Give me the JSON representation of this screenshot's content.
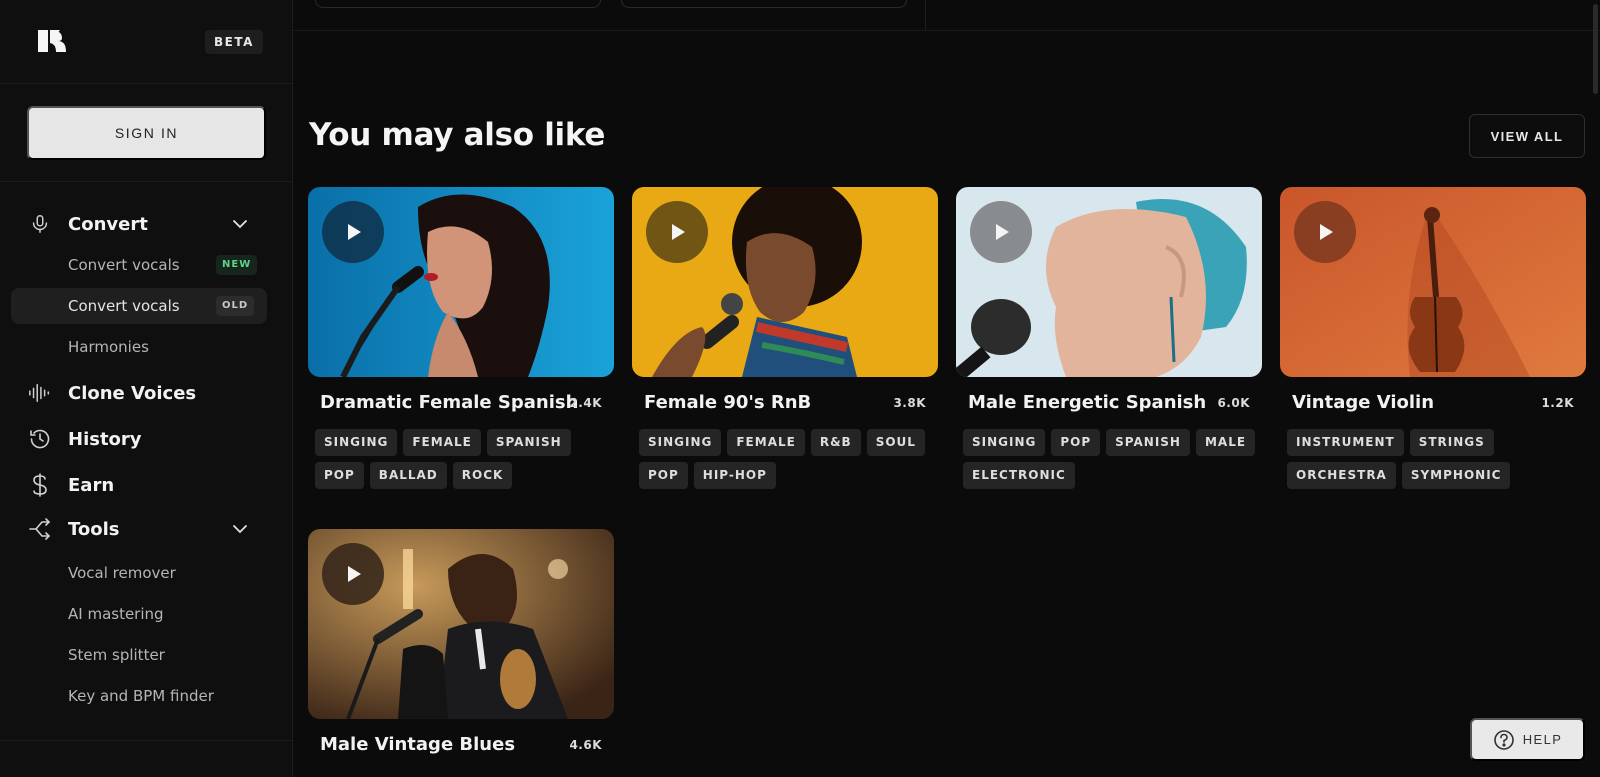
{
  "brand": {
    "badge": "BETA"
  },
  "auth": {
    "sign_in_label": "SIGN IN"
  },
  "nav": {
    "convert": {
      "label": "Convert",
      "icon": "mic-icon"
    },
    "convert_sub": [
      {
        "label": "Convert vocals",
        "tag": "NEW"
      },
      {
        "label": "Convert vocals",
        "tag": "OLD"
      },
      {
        "label": "Harmonies"
      }
    ],
    "clone": {
      "label": "Clone Voices",
      "icon": "waveform-icon"
    },
    "history": {
      "label": "History",
      "icon": "history-icon"
    },
    "earn": {
      "label": "Earn",
      "icon": "dollar-icon"
    },
    "tools": {
      "label": "Tools",
      "icon": "share-icon"
    },
    "tools_sub": [
      {
        "label": "Vocal remover"
      },
      {
        "label": "AI mastering"
      },
      {
        "label": "Stem splitter"
      },
      {
        "label": "Key and BPM finder"
      }
    ]
  },
  "section": {
    "title": "You may also like",
    "view_all_label": "VIEW ALL"
  },
  "cards": [
    {
      "title": "Dramatic Female Spanish",
      "count": "2.4K",
      "tags": [
        "SINGING",
        "FEMALE",
        "SPANISH",
        "POP",
        "BALLAD",
        "ROCK"
      ]
    },
    {
      "title": "Female 90's RnB",
      "count": "3.8K",
      "tags": [
        "SINGING",
        "FEMALE",
        "R&B",
        "SOUL",
        "POP",
        "HIP-HOP"
      ]
    },
    {
      "title": "Male Energetic Spanish",
      "count": "6.0K",
      "tags": [
        "SINGING",
        "POP",
        "SPANISH",
        "MALE",
        "ELECTRONIC"
      ]
    },
    {
      "title": "Vintage Violin",
      "count": "1.2K",
      "tags": [
        "INSTRUMENT",
        "STRINGS",
        "ORCHESTRA",
        "SYMPHONIC"
      ]
    },
    {
      "title": "Male Vintage Blues",
      "count": "4.6K",
      "tags": []
    }
  ],
  "help": {
    "label": "HELP"
  },
  "colors": {
    "background": "#0b0b0b",
    "sidebar": "#0f0f0f",
    "tag_bg": "#252525",
    "new_tag": "#5fd18a"
  }
}
